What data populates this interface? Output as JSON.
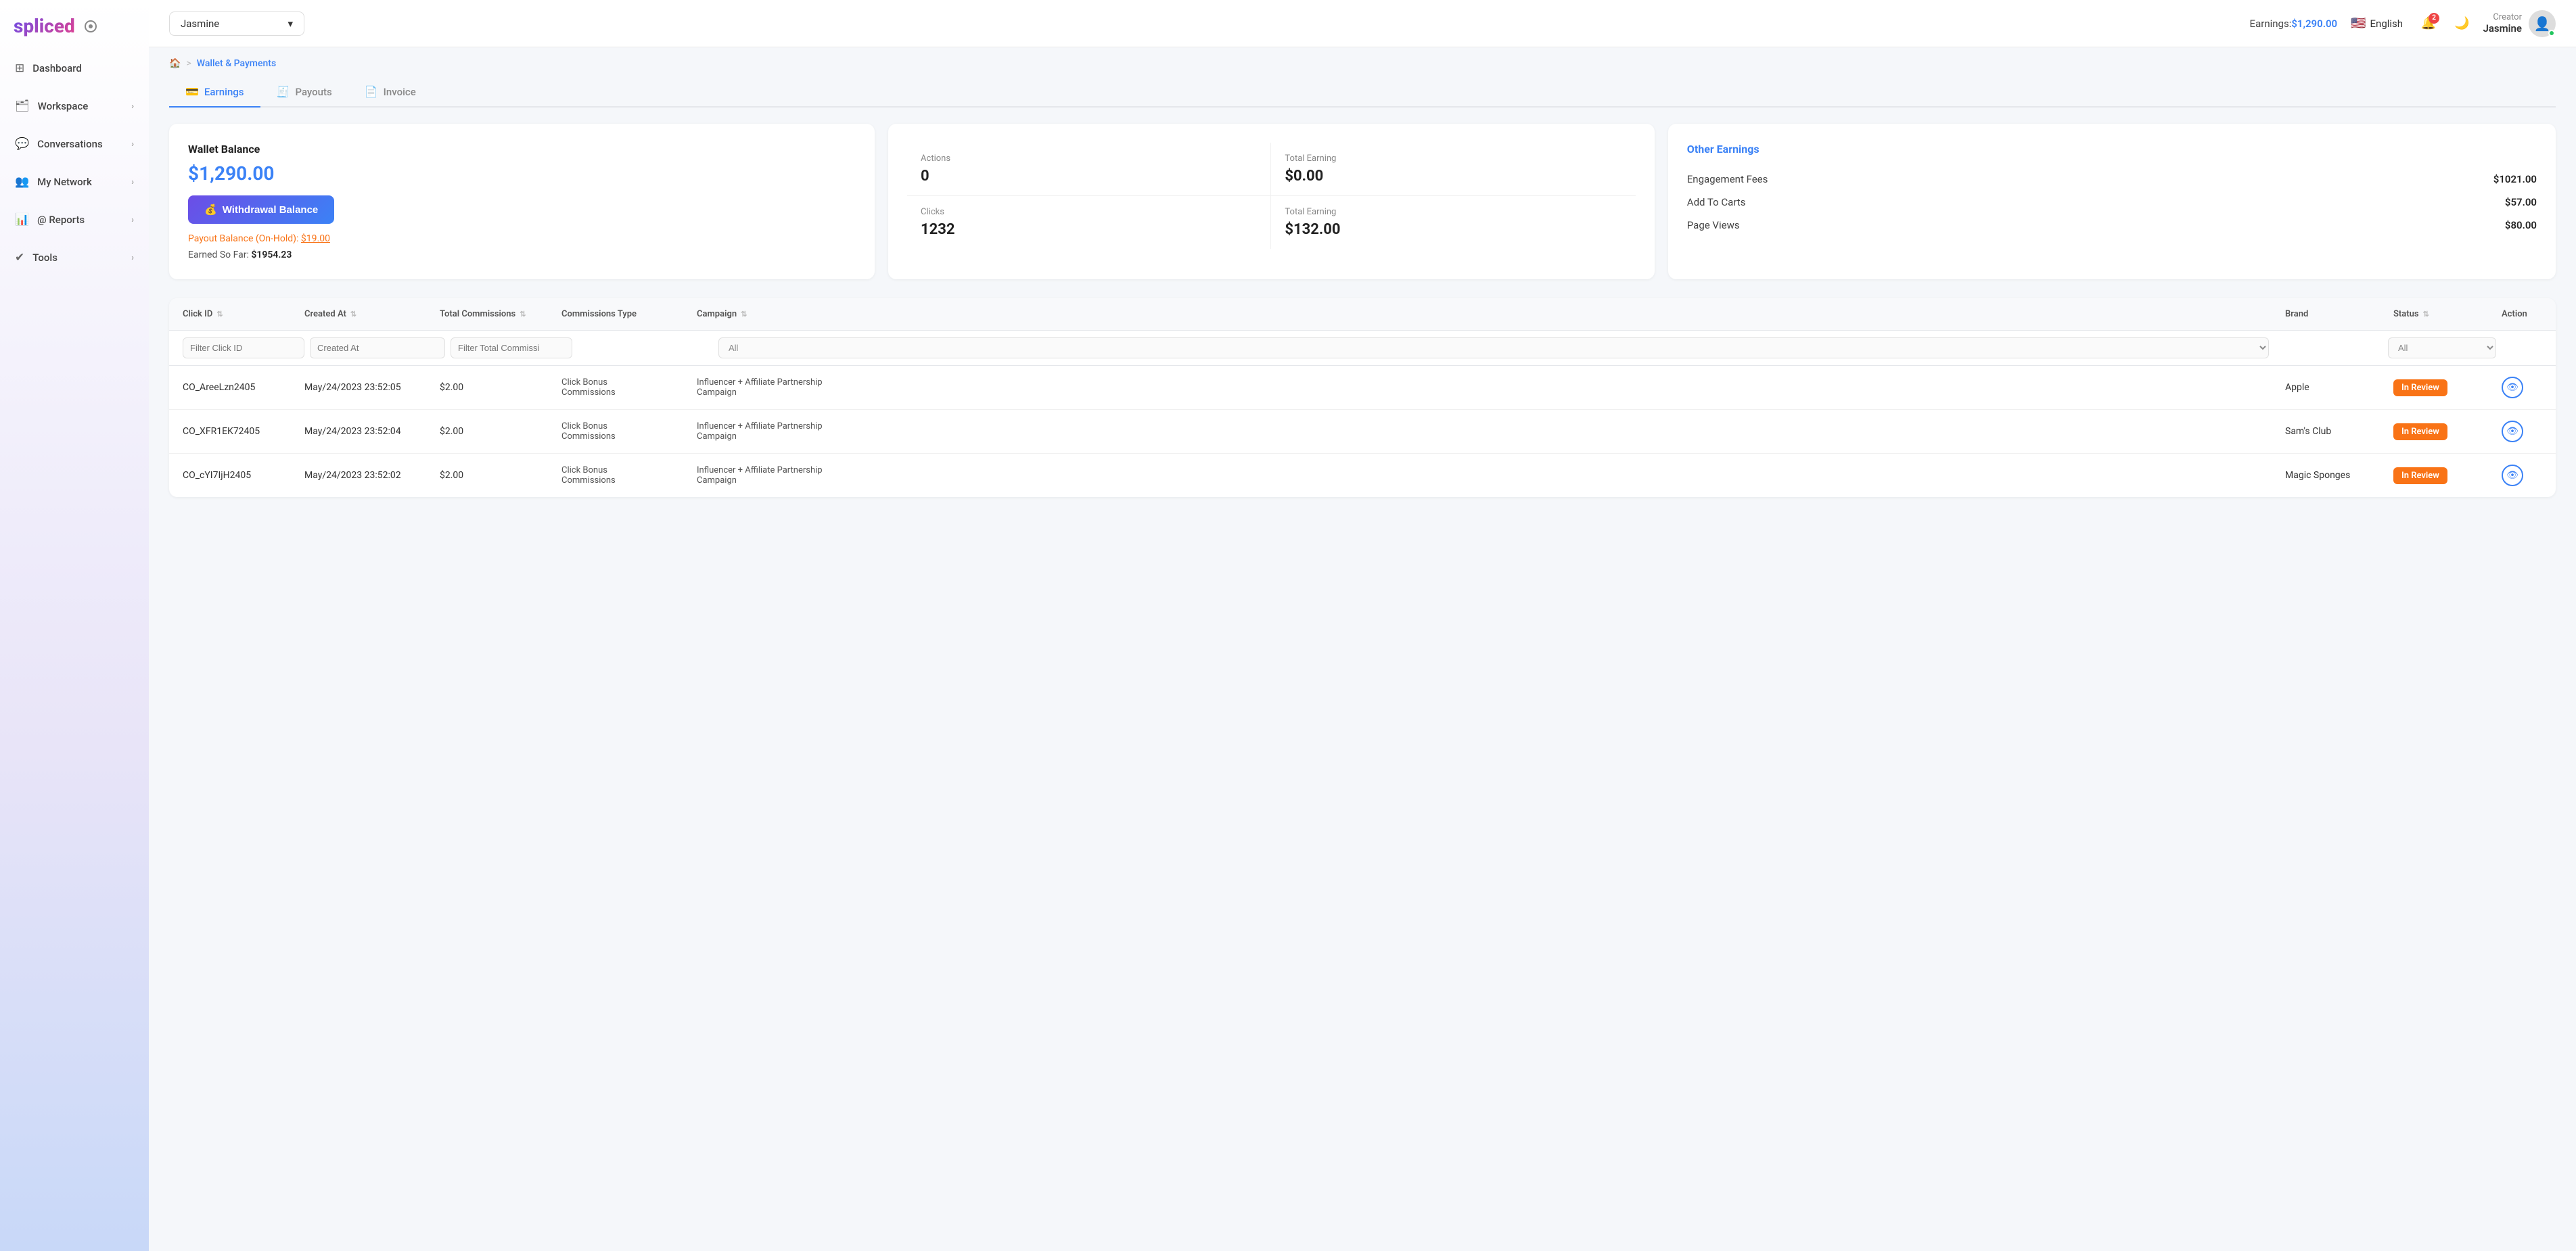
{
  "logo": {
    "text": "spliced"
  },
  "nav": {
    "items": [
      {
        "id": "dashboard",
        "label": "Dashboard",
        "icon": "⊞",
        "hasChevron": false
      },
      {
        "id": "workspace",
        "label": "Workspace",
        "icon": "🗂",
        "hasChevron": true
      },
      {
        "id": "conversations",
        "label": "Conversations",
        "icon": "💬",
        "hasChevron": true
      },
      {
        "id": "my-network",
        "label": "My Network",
        "icon": "👥",
        "hasChevron": true
      },
      {
        "id": "reports",
        "label": "@ Reports",
        "icon": "📊",
        "hasChevron": true
      },
      {
        "id": "tools",
        "label": "Tools",
        "icon": "✔",
        "hasChevron": true
      }
    ]
  },
  "topbar": {
    "workspace_selector": "Jasmine",
    "earnings_label": "Earnings:",
    "earnings_amount": "$1,290.00",
    "language": "English",
    "notif_count": "2",
    "user_role": "Creator",
    "user_name": "Jasmine"
  },
  "breadcrumb": {
    "home_icon": "🏠",
    "separator": ">",
    "current": "Wallet & Payments"
  },
  "tabs": [
    {
      "id": "earnings",
      "label": "Earnings",
      "icon": "💳",
      "active": true
    },
    {
      "id": "payouts",
      "label": "Payouts",
      "icon": "🧾",
      "active": false
    },
    {
      "id": "invoice",
      "label": "Invoice",
      "icon": "📄",
      "active": false
    }
  ],
  "wallet_card": {
    "title": "Wallet Balance",
    "amount": "$1,290.00",
    "withdrawal_btn": "Withdrawal Balance",
    "payout_hold_label": "Payout Balance (On-Hold):",
    "payout_hold_amount": "$19.00",
    "earned_label": "Earned So Far:",
    "earned_amount": "$1954.23"
  },
  "stats_card": {
    "cells": [
      {
        "label": "Actions",
        "value": "0"
      },
      {
        "label": "Total Earning",
        "value": "$0.00"
      },
      {
        "label": "Clicks",
        "value": "1232"
      },
      {
        "label": "Total Earning",
        "value": "$132.00"
      }
    ]
  },
  "other_earnings": {
    "title": "Other Earnings",
    "items": [
      {
        "label": "Engagement Fees",
        "amount": "$1021.00"
      },
      {
        "label": "Add To Carts",
        "amount": "$57.00"
      },
      {
        "label": "Page Views",
        "amount": "$80.00"
      }
    ]
  },
  "table": {
    "columns": [
      {
        "id": "click-id",
        "label": "Click ID",
        "sortable": true
      },
      {
        "id": "created-at",
        "label": "Created At",
        "sortable": true
      },
      {
        "id": "total-commissions",
        "label": "Total Commissions",
        "sortable": true
      },
      {
        "id": "commissions-type",
        "label": "Commissions Type",
        "sortable": false
      },
      {
        "id": "campaign",
        "label": "Campaign",
        "sortable": true
      },
      {
        "id": "brand",
        "label": "Brand",
        "sortable": false
      },
      {
        "id": "status",
        "label": "Status",
        "sortable": true
      },
      {
        "id": "action",
        "label": "Action",
        "sortable": false
      }
    ],
    "filters": {
      "click_id_placeholder": "Filter Click ID",
      "created_at_placeholder": "Created At",
      "total_commissions_placeholder": "Filter Total Commissi",
      "campaign_placeholder": "All",
      "status_placeholder": "All"
    },
    "rows": [
      {
        "click_id": "CO_AreeLzn2405",
        "created_at": "May/24/2023 23:52:05",
        "total_commissions": "$2.00",
        "commissions_type": "Click Bonus\nCommissions",
        "campaign": "Influencer + Affiliate Partnership\nCampaign",
        "brand": "Apple",
        "status": "In Review",
        "status_color": "#f97316"
      },
      {
        "click_id": "CO_XFR1EK72405",
        "created_at": "May/24/2023 23:52:04",
        "total_commissions": "$2.00",
        "commissions_type": "Click Bonus\nCommissions",
        "campaign": "Influencer + Affiliate Partnership\nCampaign",
        "brand": "Sam's Club",
        "status": "In Review",
        "status_color": "#f97316"
      },
      {
        "click_id": "CO_cYI7IjH2405",
        "created_at": "May/24/2023 23:52:02",
        "total_commissions": "$2.00",
        "commissions_type": "Click Bonus\nCommissions",
        "campaign": "Influencer + Affiliate Partnership\nCampaign",
        "brand": "Magic Sponges",
        "status": "In Review",
        "status_color": "#f97316"
      }
    ]
  }
}
